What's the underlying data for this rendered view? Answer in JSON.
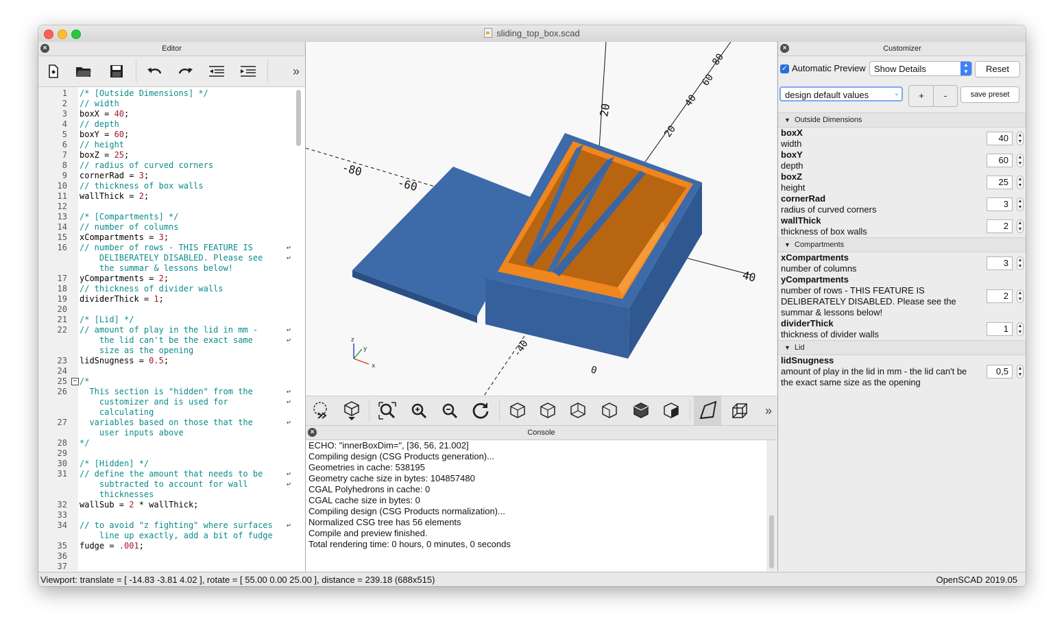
{
  "window": {
    "title": "sliding_top_box.scad"
  },
  "editor": {
    "title": "Editor",
    "toolbar": [
      "new-file-icon",
      "open-file-icon",
      "save-icon",
      "undo-icon",
      "redo-icon",
      "unindent-icon",
      "indent-icon",
      "more-icon"
    ],
    "lines": [
      {
        "n": "1",
        "t": "/* [Outside Dimensions] */",
        "k": "cm"
      },
      {
        "n": "",
        "t": "// width",
        "k": "cm",
        "n2": "2"
      },
      {
        "n": "3",
        "t": "boxX = 40;",
        "k": "code"
      },
      {
        "n": "4",
        "t": "// depth",
        "k": "cm"
      },
      {
        "n": "5",
        "t": "boxY = 60;",
        "k": "code"
      },
      {
        "n": "6",
        "t": "// height",
        "k": "cm"
      },
      {
        "n": "7",
        "t": "boxZ = 25;",
        "k": "code"
      },
      {
        "n": "8",
        "t": "// radius of curved corners",
        "k": "cm"
      },
      {
        "n": "9",
        "t": "cornerRad = 3;",
        "k": "code"
      },
      {
        "n": "10",
        "t": "// thickness of box walls",
        "k": "cm"
      },
      {
        "n": "11",
        "t": "wallThick = 2;",
        "k": "code"
      },
      {
        "n": "12",
        "t": "",
        "k": "code"
      },
      {
        "n": "13",
        "t": "/* [Compartments] */",
        "k": "cm"
      },
      {
        "n": "14",
        "t": "// number of columns",
        "k": "cm"
      },
      {
        "n": "15",
        "t": "xCompartments = 3;",
        "k": "code"
      },
      {
        "n": "16",
        "t": "// number of rows - THIS FEATURE IS",
        "k": "cm",
        "w": true
      },
      {
        "n": "",
        "t": "    DELIBERATELY DISABLED. Please see",
        "k": "cm",
        "w": true
      },
      {
        "n": "",
        "t": "    the summar & lessons below!",
        "k": "cm"
      },
      {
        "n": "17",
        "t": "yCompartments = 2;",
        "k": "code"
      },
      {
        "n": "18",
        "t": "// thickness of divider walls",
        "k": "cm"
      },
      {
        "n": "19",
        "t": "dividerThick = 1;",
        "k": "code"
      },
      {
        "n": "20",
        "t": "",
        "k": "code"
      },
      {
        "n": "21",
        "t": "/* [Lid] */",
        "k": "cm"
      },
      {
        "n": "22",
        "t": "// amount of play in the lid in mm -",
        "k": "cm",
        "w": true
      },
      {
        "n": "",
        "t": "    the lid can't be the exact same",
        "k": "cm",
        "w": true
      },
      {
        "n": "",
        "t": "    size as the opening",
        "k": "cm"
      },
      {
        "n": "23",
        "t": "lidSnugness = 0.5;",
        "k": "code"
      },
      {
        "n": "24",
        "t": "",
        "k": "code"
      },
      {
        "n": "25",
        "t": "/*",
        "k": "cm",
        "f": true
      },
      {
        "n": "26",
        "t": "  This section is \"hidden\" from the",
        "k": "cm",
        "w": true
      },
      {
        "n": "",
        "t": "    customizer and is used for",
        "k": "cm",
        "w": true
      },
      {
        "n": "",
        "t": "    calculating",
        "k": "cm"
      },
      {
        "n": "27",
        "t": "  variables based on those that the",
        "k": "cm",
        "w": true
      },
      {
        "n": "",
        "t": "    user inputs above",
        "k": "cm"
      },
      {
        "n": "28",
        "t": "*/",
        "k": "cm"
      },
      {
        "n": "29",
        "t": "",
        "k": "code"
      },
      {
        "n": "30",
        "t": "/* [Hidden] */",
        "k": "cm"
      },
      {
        "n": "31",
        "t": "// define the amount that needs to be",
        "k": "cm",
        "w": true
      },
      {
        "n": "",
        "t": "    subtracted to account for wall",
        "k": "cm",
        "w": true
      },
      {
        "n": "",
        "t": "    thicknesses",
        "k": "cm"
      },
      {
        "n": "32",
        "t": "wallSub = 2 * wallThick;",
        "k": "code"
      },
      {
        "n": "33",
        "t": "",
        "k": "code"
      },
      {
        "n": "34",
        "t": "// to avoid \"z fighting\" where surfaces",
        "k": "cm",
        "w": true
      },
      {
        "n": "",
        "t": "    line up exactly, add a bit of fudge",
        "k": "cm"
      },
      {
        "n": "35",
        "t": "fudge = .001;",
        "k": "code"
      },
      {
        "n": "36",
        "t": "",
        "k": "code"
      },
      {
        "n": "37",
        "t": "",
        "k": "code"
      }
    ]
  },
  "viewport": {
    "axis_labels": {
      "x": "x",
      "y": "y",
      "z": "z"
    }
  },
  "console": {
    "title": "Console",
    "lines": [
      "ECHO: \"innerBoxDim=\", [36, 56, 21.002]",
      "Compiling design (CSG Products generation)...",
      "Geometries in cache: 538195",
      "Geometry cache size in bytes: 104857480",
      "CGAL Polyhedrons in cache: 0",
      "CGAL cache size in bytes: 0",
      "Compiling design (CSG Products normalization)...",
      "Normalized CSG tree has 56 elements",
      "Compile and preview finished.",
      "Total rendering time: 0 hours, 0 minutes, 0 seconds"
    ]
  },
  "customizer": {
    "title": "Customizer",
    "auto_preview_label": "Automatic Preview",
    "details_select": "Show Details",
    "reset_label": "Reset",
    "preset_select": "design default values",
    "plus_label": "+",
    "minus_label": "-",
    "save_preset_label": "save preset",
    "groups": [
      {
        "name": "Outside Dimensions",
        "params": [
          {
            "name": "boxX",
            "desc": "width",
            "value": "40"
          },
          {
            "name": "boxY",
            "desc": "depth",
            "value": "60"
          },
          {
            "name": "boxZ",
            "desc": "height",
            "value": "25"
          },
          {
            "name": "cornerRad",
            "desc": "radius of curved corners",
            "value": "3"
          },
          {
            "name": "wallThick",
            "desc": "thickness of box walls",
            "value": "2"
          }
        ]
      },
      {
        "name": "Compartments",
        "params": [
          {
            "name": "xCompartments",
            "desc": "number of columns",
            "value": "3"
          },
          {
            "name": "yCompartments",
            "desc": "number of rows - THIS FEATURE IS DELIBERATELY DISABLED. Please see the summar & lessons below!",
            "value": "2"
          },
          {
            "name": "dividerThick",
            "desc": "thickness of divider walls",
            "value": "1"
          }
        ]
      },
      {
        "name": "Lid",
        "params": [
          {
            "name": "lidSnugness",
            "desc": "amount of play in the lid in mm - the lid can't be the exact same size as the opening",
            "value": "0,5"
          }
        ]
      }
    ]
  },
  "status": {
    "viewport_info": "Viewport: translate = [ -14.83 -3.81 4.02 ], rotate = [ 55.00 0.00 25.00 ], distance = 239.18 (688x515)",
    "version": "OpenSCAD 2019.05"
  },
  "colors": {
    "box": "#3d6aa8",
    "inner": "#f0861e",
    "close": "#fe5f57",
    "minimize": "#febc2e",
    "zoom": "#28c840"
  }
}
